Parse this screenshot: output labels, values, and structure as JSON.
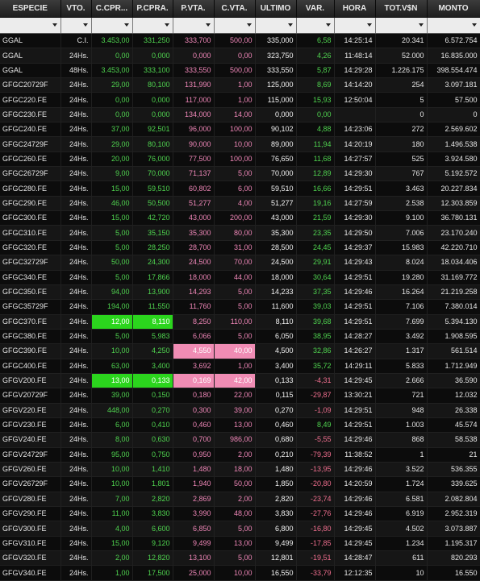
{
  "table": {
    "columns": [
      "ESPECIE",
      "VTO.",
      "C.CPR...",
      "P.CPRA.",
      "P.VTA.",
      "C.VTA.",
      "ULTIMO",
      "VAR.",
      "HORA",
      "TOT.V$N",
      "MONTO"
    ],
    "highlights": [
      {
        "row": 19,
        "col": 2,
        "type": "bid"
      },
      {
        "row": 19,
        "col": 3,
        "type": "bid"
      },
      {
        "row": 21,
        "col": 4,
        "type": "ask"
      },
      {
        "row": 21,
        "col": 5,
        "type": "ask"
      },
      {
        "row": 23,
        "col": 2,
        "type": "bid"
      },
      {
        "row": 23,
        "col": 3,
        "type": "bid"
      },
      {
        "row": 23,
        "col": 4,
        "type": "ask"
      },
      {
        "row": 23,
        "col": 5,
        "type": "ask"
      }
    ],
    "rows": [
      [
        "GGAL",
        "C.I.",
        "3.453,00",
        "331,250",
        "333,700",
        "500,00",
        "335,000",
        "6,58",
        "14:25:14",
        "20.341",
        "6.572.754"
      ],
      [
        "GGAL",
        "24Hs.",
        "0,00",
        "0,000",
        "0,000",
        "0,00",
        "323,750",
        "4,26",
        "11:48:14",
        "52.000",
        "16.835.000"
      ],
      [
        "GGAL",
        "48Hs.",
        "3.453,00",
        "333,100",
        "333,550",
        "500,00",
        "333,550",
        "5,87",
        "14:29:28",
        "1.226.175",
        "398.554.474"
      ],
      [
        "GFGC20729F",
        "24Hs.",
        "29,00",
        "80,100",
        "131,990",
        "1,00",
        "125,000",
        "8,69",
        "14:14:20",
        "254",
        "3.097.181"
      ],
      [
        "GFGC220.FE",
        "24Hs.",
        "0,00",
        "0,000",
        "117,000",
        "1,00",
        "115,000",
        "15,93",
        "12:50:04",
        "5",
        "57.500"
      ],
      [
        "GFGC230.FE",
        "24Hs.",
        "0,00",
        "0,000",
        "134,000",
        "14,00",
        "0,000",
        "0,00",
        "",
        "0",
        "0"
      ],
      [
        "GFGC240.FE",
        "24Hs.",
        "37,00",
        "92,501",
        "96,000",
        "100,00",
        "90,102",
        "4,88",
        "14:23:06",
        "272",
        "2.569.602"
      ],
      [
        "GFGC24729F",
        "24Hs.",
        "29,00",
        "80,100",
        "90,000",
        "10,00",
        "89,000",
        "11,94",
        "14:20:19",
        "180",
        "1.496.538"
      ],
      [
        "GFGC260.FE",
        "24Hs.",
        "20,00",
        "76,000",
        "77,500",
        "100,00",
        "76,650",
        "11,68",
        "14:27:57",
        "525",
        "3.924.580"
      ],
      [
        "GFGC26729F",
        "24Hs.",
        "9,00",
        "70,000",
        "71,137",
        "5,00",
        "70,000",
        "12,89",
        "14:29:30",
        "767",
        "5.192.572"
      ],
      [
        "GFGC280.FE",
        "24Hs.",
        "15,00",
        "59,510",
        "60,802",
        "6,00",
        "59,510",
        "16,66",
        "14:29:51",
        "3.463",
        "20.227.834"
      ],
      [
        "GFGC290.FE",
        "24Hs.",
        "46,00",
        "50,500",
        "51,277",
        "4,00",
        "51,277",
        "19,16",
        "14:27:59",
        "2.538",
        "12.303.859"
      ],
      [
        "GFGC300.FE",
        "24Hs.",
        "15,00",
        "42,720",
        "43,000",
        "200,00",
        "43,000",
        "21,59",
        "14:29:30",
        "9.100",
        "36.780.131"
      ],
      [
        "GFGC310.FE",
        "24Hs.",
        "5,00",
        "35,150",
        "35,300",
        "80,00",
        "35,300",
        "23,35",
        "14:29:50",
        "7.006",
        "23.170.240"
      ],
      [
        "GFGC320.FE",
        "24Hs.",
        "5,00",
        "28,250",
        "28,700",
        "31,00",
        "28,500",
        "24,45",
        "14:29:37",
        "15.983",
        "42.220.710"
      ],
      [
        "GFGC32729F",
        "24Hs.",
        "50,00",
        "24,300",
        "24,500",
        "70,00",
        "24,500",
        "29,91",
        "14:29:43",
        "8.024",
        "18.034.406"
      ],
      [
        "GFGC340.FE",
        "24Hs.",
        "5,00",
        "17,866",
        "18,000",
        "44,00",
        "18,000",
        "30,64",
        "14:29:51",
        "19.280",
        "31.169.772"
      ],
      [
        "GFGC350.FE",
        "24Hs.",
        "94,00",
        "13,900",
        "14,293",
        "5,00",
        "14,233",
        "37,35",
        "14:29:46",
        "16.264",
        "21.219.258"
      ],
      [
        "GFGC35729F",
        "24Hs.",
        "194,00",
        "11,550",
        "11,760",
        "5,00",
        "11,600",
        "39,03",
        "14:29:51",
        "7.106",
        "7.380.014"
      ],
      [
        "GFGC370.FE",
        "24Hs.",
        "12,00",
        "8,110",
        "8,250",
        "110,00",
        "8,110",
        "39,68",
        "14:29:51",
        "7.699",
        "5.394.130"
      ],
      [
        "GFGC380.FE",
        "24Hs.",
        "5,00",
        "5,983",
        "6,066",
        "5,00",
        "6,050",
        "38,95",
        "14:28:27",
        "3.492",
        "1.908.595"
      ],
      [
        "GFGC390.FE",
        "24Hs.",
        "10,00",
        "4,250",
        "4,550",
        "40,00",
        "4,500",
        "32,86",
        "14:26:27",
        "1.317",
        "561.514"
      ],
      [
        "GFGC400.FE",
        "24Hs.",
        "63,00",
        "3,400",
        "3,692",
        "1,00",
        "3,400",
        "35,72",
        "14:29:11",
        "5.833",
        "1.712.949"
      ],
      [
        "GFGV200.FE",
        "24Hs.",
        "13,00",
        "0,133",
        "0,169",
        "42,00",
        "0,133",
        "-4,31",
        "14:29:45",
        "2.666",
        "36.590"
      ],
      [
        "GFGV20729F",
        "24Hs.",
        "39,00",
        "0,150",
        "0,180",
        "22,00",
        "0,115",
        "-29,87",
        "13:30:21",
        "721",
        "12.032"
      ],
      [
        "GFGV220.FE",
        "24Hs.",
        "448,00",
        "0,270",
        "0,300",
        "39,00",
        "0,270",
        "-1,09",
        "14:29:51",
        "948",
        "26.338"
      ],
      [
        "GFGV230.FE",
        "24Hs.",
        "6,00",
        "0,410",
        "0,460",
        "13,00",
        "0,460",
        "8,49",
        "14:29:51",
        "1.003",
        "45.574"
      ],
      [
        "GFGV240.FE",
        "24Hs.",
        "8,00",
        "0,630",
        "0,700",
        "986,00",
        "0,680",
        "-5,55",
        "14:29:46",
        "868",
        "58.538"
      ],
      [
        "GFGV24729F",
        "24Hs.",
        "95,00",
        "0,750",
        "0,950",
        "2,00",
        "0,210",
        "-79,39",
        "11:38:52",
        "1",
        "21"
      ],
      [
        "GFGV260.FE",
        "24Hs.",
        "10,00",
        "1,410",
        "1,480",
        "18,00",
        "1,480",
        "-13,95",
        "14:29:46",
        "3.522",
        "536.355"
      ],
      [
        "GFGV26729F",
        "24Hs.",
        "10,00",
        "1,801",
        "1,940",
        "50,00",
        "1,850",
        "-20,80",
        "14:20:59",
        "1.724",
        "339.625"
      ],
      [
        "GFGV280.FE",
        "24Hs.",
        "7,00",
        "2,820",
        "2,869",
        "2,00",
        "2,820",
        "-23,74",
        "14:29:46",
        "6.581",
        "2.082.804"
      ],
      [
        "GFGV290.FE",
        "24Hs.",
        "11,00",
        "3,830",
        "3,990",
        "48,00",
        "3,830",
        "-27,76",
        "14:29:46",
        "6.919",
        "2.952.319"
      ],
      [
        "GFGV300.FE",
        "24Hs.",
        "4,00",
        "6,600",
        "6,850",
        "5,00",
        "6,800",
        "-16,80",
        "14:29:45",
        "4.502",
        "3.073.887"
      ],
      [
        "GFGV310.FE",
        "24Hs.",
        "15,00",
        "9,120",
        "9,499",
        "13,00",
        "9,499",
        "-17,85",
        "14:29:45",
        "1.234",
        "1.195.317"
      ],
      [
        "GFGV320.FE",
        "24Hs.",
        "2,00",
        "12,820",
        "13,100",
        "5,00",
        "12,801",
        "-19,51",
        "14:28:47",
        "611",
        "820.293"
      ],
      [
        "GFGV340.FE",
        "24Hs.",
        "1,00",
        "17,500",
        "25,000",
        "10,00",
        "16,550",
        "-33,79",
        "12:12:35",
        "10",
        "16.550"
      ]
    ]
  }
}
